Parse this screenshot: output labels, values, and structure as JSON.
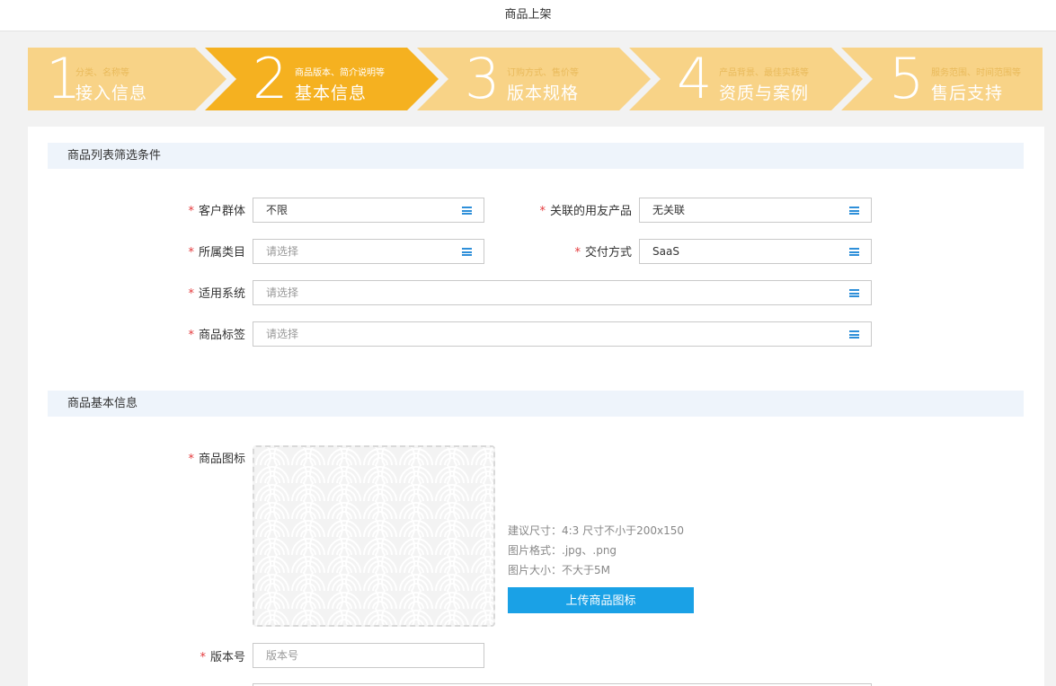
{
  "header": {
    "title": "商品上架"
  },
  "steps": [
    {
      "num": "1",
      "sub": "分类、名称等",
      "title": "接入信息",
      "active": false
    },
    {
      "num": "2",
      "sub": "商品版本、简介说明等",
      "title": "基本信息",
      "active": true
    },
    {
      "num": "3",
      "sub": "订购方式、售价等",
      "title": "版本规格",
      "active": false
    },
    {
      "num": "4",
      "sub": "产品背景、最佳实践等",
      "title": "资质与案例",
      "active": false
    },
    {
      "num": "5",
      "sub": "服务范围、时间范围等",
      "title": "售后支持",
      "active": false
    }
  ],
  "filter_section": {
    "title": "商品列表筛选条件",
    "required_mark": "*",
    "customer_group": {
      "label": "客户群体",
      "value": "不限"
    },
    "related_product": {
      "label": "关联的用友产品",
      "value": "无关联"
    },
    "category": {
      "label": "所属类目",
      "placeholder": "请选择"
    },
    "delivery": {
      "label": "交付方式",
      "value": "SaaS"
    },
    "system": {
      "label": "适用系统",
      "placeholder": "请选择"
    },
    "tags": {
      "label": "商品标签",
      "placeholder": "请选择"
    }
  },
  "basic_section": {
    "title": "商品基本信息",
    "icon_label": "商品图标",
    "hints": [
      "建议尺寸：4:3 尺寸不小于200x150",
      "图片格式：.jpg、.png",
      "图片大小：不大于5M"
    ],
    "upload_button": "上传商品图标",
    "version_label": "版本号",
    "version_placeholder": "版本号"
  },
  "colors": {
    "step_inactive": "#f8d387",
    "step_active": "#f5b120",
    "accent": "#1aa1e6",
    "required": "#e4393c",
    "section_bg": "#eef4fb"
  },
  "icons": {
    "select": "menu-icon"
  }
}
